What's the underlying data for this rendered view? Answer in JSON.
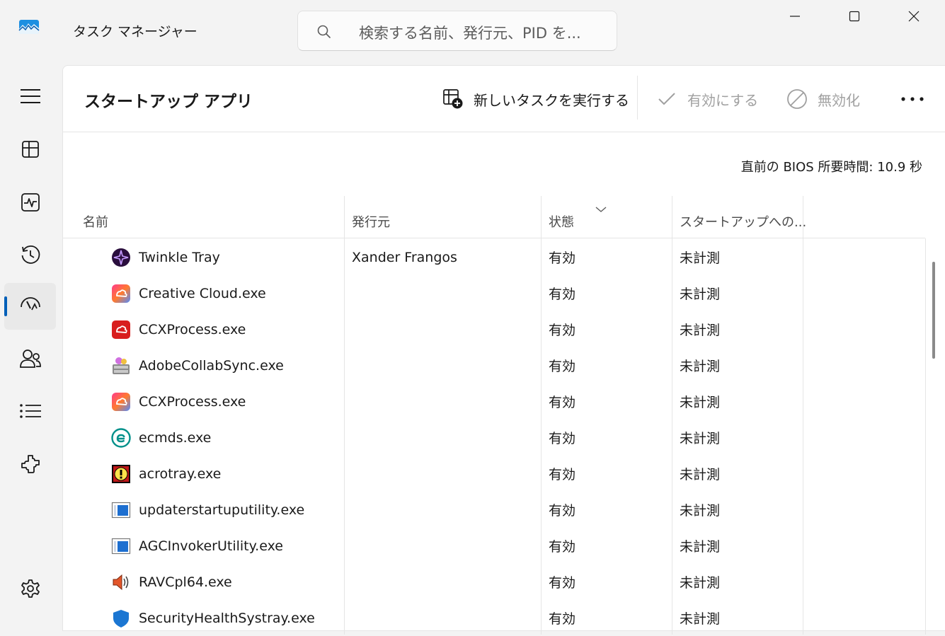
{
  "app": {
    "title": "タスク マネージャー",
    "search_placeholder": "検索する名前、発行元、PID を..."
  },
  "nav": {
    "items": [
      {
        "icon": "hamburger-menu-icon"
      },
      {
        "icon": "processes-icon"
      },
      {
        "icon": "performance-icon"
      },
      {
        "icon": "app-history-icon"
      },
      {
        "icon": "startup-apps-icon",
        "active": true
      },
      {
        "icon": "users-icon"
      },
      {
        "icon": "details-icon"
      },
      {
        "icon": "services-icon"
      },
      {
        "icon": "settings-icon"
      }
    ]
  },
  "page": {
    "title": "スタートアップ アプリ",
    "run_task_label": "新しいタスクを実行する",
    "enable_label": "有効にする",
    "disable_label": "無効化",
    "bios_time": "直前の BIOS 所要時間:  10.9 秒"
  },
  "table": {
    "columns": [
      "名前",
      "発行元",
      "状態",
      "スタートアップへの..."
    ],
    "rows": [
      {
        "name": "Twinkle Tray",
        "publisher": "Xander Frangos",
        "status": "有効",
        "impact": "未計測",
        "icon": "twinkle-tray-icon"
      },
      {
        "name": "Creative Cloud.exe",
        "publisher": "",
        "status": "有効",
        "impact": "未計測",
        "icon": "creative-cloud-icon"
      },
      {
        "name": "CCXProcess.exe",
        "publisher": "",
        "status": "有効",
        "impact": "未計測",
        "icon": "ccx-process-red-icon"
      },
      {
        "name": "AdobeCollabSync.exe",
        "publisher": "",
        "status": "有効",
        "impact": "未計測",
        "icon": "adobe-collab-sync-icon"
      },
      {
        "name": "CCXProcess.exe",
        "publisher": "",
        "status": "有効",
        "impact": "未計測",
        "icon": "creative-cloud-icon"
      },
      {
        "name": "ecmds.exe",
        "publisher": "",
        "status": "有効",
        "impact": "未計測",
        "icon": "eset-icon"
      },
      {
        "name": "acrotray.exe",
        "publisher": "",
        "status": "有効",
        "impact": "未計測",
        "icon": "acrotray-warning-icon"
      },
      {
        "name": "updaterstartuputility.exe",
        "publisher": "",
        "status": "有効",
        "impact": "未計測",
        "icon": "window-app-icon"
      },
      {
        "name": "AGCInvokerUtility.exe",
        "publisher": "",
        "status": "有効",
        "impact": "未計測",
        "icon": "window-app-icon"
      },
      {
        "name": "RAVCpl64.exe",
        "publisher": "",
        "status": "有効",
        "impact": "未計測",
        "icon": "speaker-icon"
      },
      {
        "name": "SecurityHealthSystray.exe",
        "publisher": "",
        "status": "有効",
        "impact": "未計測",
        "icon": "windows-security-icon"
      }
    ]
  },
  "colors": {
    "accent": "#005fb8",
    "background": "#f3f3f3",
    "panel": "#ffffff"
  }
}
